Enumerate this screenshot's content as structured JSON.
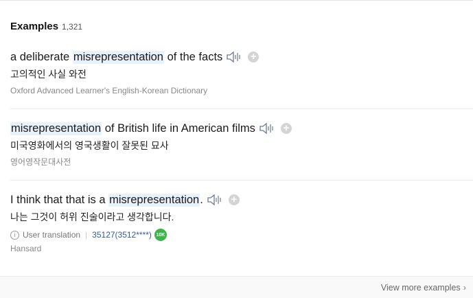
{
  "header": {
    "title": "Examples",
    "count": "1,321"
  },
  "examples": [
    {
      "pre": "a deliberate ",
      "highlight": "misrepresentation",
      "post": " of the facts",
      "translation": "고의적인 사실 와전",
      "source": "Oxford Advanced Learner's English-Korean Dictionary"
    },
    {
      "pre": "",
      "highlight": "misrepresentation",
      "post": " of British life in American films",
      "translation": "미국영화에서의 영국생활이 잘못된 묘사",
      "source": "영어영작문대사전"
    },
    {
      "pre": "I think that that is a ",
      "highlight": "misrepresentation",
      "post": ".",
      "translation": "나는 그것이 허위 진술이라고 생각합니다.",
      "info_icon": "i",
      "user_translation_label": "User translation",
      "user_id": "35127(3512****)",
      "badge": "10K",
      "source": "Hansard"
    }
  ],
  "footer": {
    "view_more": "View more examples",
    "chevron": "›"
  },
  "icons": {
    "speaker": "speaker-icon",
    "add": "plus-icon",
    "info": "info-icon"
  },
  "colors": {
    "highlight": "#e8f2fb",
    "badge": "#3cb54a",
    "user_link": "#335aa0"
  }
}
